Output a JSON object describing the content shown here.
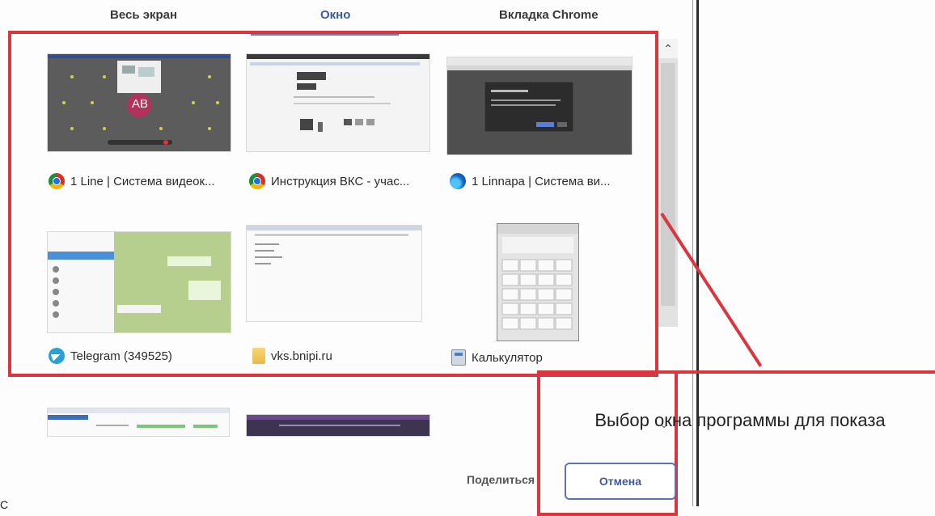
{
  "tabs": {
    "full_screen": "Весь экран",
    "window": "Окно",
    "chrome_tab": "Вкладка Chrome"
  },
  "windows": [
    {
      "label": "1 Line | Система видеок...",
      "icon": "chrome-icon"
    },
    {
      "label": "Инструкция ВКС - учас...",
      "icon": "chrome-icon"
    },
    {
      "label": "1 Linnapa | Система ви...",
      "icon": "edge-icon"
    },
    {
      "label": "Telegram (349525)",
      "icon": "telegram-icon"
    },
    {
      "label": "vks.bnipi.ru",
      "icon": "folder-icon"
    },
    {
      "label": "Калькулятор",
      "icon": "calculator-icon"
    }
  ],
  "avatar_initials": "AB",
  "annotation": {
    "text": "Выбор окна программы для показа"
  },
  "footer": {
    "share_label": "Поделиться",
    "cancel_label": "Отмена",
    "bottom_letter": "С"
  },
  "colors": {
    "accent": "#3f5aa3",
    "annotation_red": "#d9363e"
  }
}
